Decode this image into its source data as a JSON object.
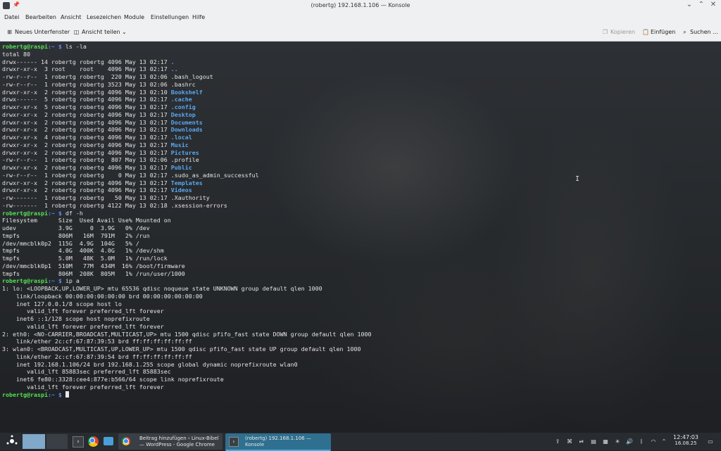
{
  "window": {
    "title": "(robertg) 192.168.1.106 — Konsole"
  },
  "menu": [
    "Datei",
    "Bearbeiten",
    "Ansicht",
    "Lesezeichen",
    "Module",
    "Einstellungen",
    "Hilfe"
  ],
  "toolbar": {
    "new_tab": "Neues Unterfenster",
    "split_view": "Ansicht teilen",
    "copy": "Kopieren",
    "paste": "Einfügen",
    "search": "Suchen …"
  },
  "terminal": {
    "prompt_user": "robertg@raspi",
    "prompt_path": ":~ $",
    "cmd_ls": " ls -la",
    "ls_total": "total 80",
    "ls_rows": [
      {
        "meta": "drwx------ 14 robertg robertg 4096 May 13 02:17 ",
        "name": ".",
        "dir": true
      },
      {
        "meta": "drwxr-xr-x  3 root    root    4096 May 13 02:17 ",
        "name": "..",
        "dir": true
      },
      {
        "meta": "-rw-r--r--  1 robertg robertg  220 May 13 02:06 ",
        "name": ".bash_logout",
        "dir": false
      },
      {
        "meta": "-rw-r--r--  1 robertg robertg 3523 May 13 02:06 ",
        "name": ".bashrc",
        "dir": false
      },
      {
        "meta": "drwxr-xr-x  2 robertg robertg 4096 May 13 02:10 ",
        "name": "Bookshelf",
        "dir": true
      },
      {
        "meta": "drwx------  5 robertg robertg 4096 May 13 02:17 ",
        "name": ".cache",
        "dir": true
      },
      {
        "meta": "drwxr-xr-x  5 robertg robertg 4096 May 13 02:17 ",
        "name": ".config",
        "dir": true
      },
      {
        "meta": "drwxr-xr-x  2 robertg robertg 4096 May 13 02:17 ",
        "name": "Desktop",
        "dir": true
      },
      {
        "meta": "drwxr-xr-x  2 robertg robertg 4096 May 13 02:17 ",
        "name": "Documents",
        "dir": true
      },
      {
        "meta": "drwxr-xr-x  2 robertg robertg 4096 May 13 02:17 ",
        "name": "Downloads",
        "dir": true
      },
      {
        "meta": "drwxr-xr-x  4 robertg robertg 4096 May 13 02:17 ",
        "name": ".local",
        "dir": true
      },
      {
        "meta": "drwxr-xr-x  2 robertg robertg 4096 May 13 02:17 ",
        "name": "Music",
        "dir": true
      },
      {
        "meta": "drwxr-xr-x  2 robertg robertg 4096 May 13 02:17 ",
        "name": "Pictures",
        "dir": true
      },
      {
        "meta": "-rw-r--r--  1 robertg robertg  807 May 13 02:06 ",
        "name": ".profile",
        "dir": false
      },
      {
        "meta": "drwxr-xr-x  2 robertg robertg 4096 May 13 02:17 ",
        "name": "Public",
        "dir": true
      },
      {
        "meta": "-rw-r--r--  1 robertg robertg    0 May 13 02:17 ",
        "name": ".sudo_as_admin_successful",
        "dir": false
      },
      {
        "meta": "drwxr-xr-x  2 robertg robertg 4096 May 13 02:17 ",
        "name": "Templates",
        "dir": true
      },
      {
        "meta": "drwxr-xr-x  2 robertg robertg 4096 May 13 02:17 ",
        "name": "Videos",
        "dir": true
      },
      {
        "meta": "-rw-------  1 robertg robertg   50 May 13 02:17 ",
        "name": ".Xauthority",
        "dir": false
      },
      {
        "meta": "-rw-------  1 robertg robertg 4122 May 13 02:18 ",
        "name": ".xsession-errors",
        "dir": false
      }
    ],
    "cmd_df": " df -h",
    "df_lines": [
      "Filesystem      Size  Used Avail Use% Mounted on",
      "udev            3.9G     0  3.9G   0% /dev",
      "tmpfs           806M   16M  791M   2% /run",
      "/dev/mmcblk0p2  115G  4.9G  104G   5% /",
      "tmpfs           4.0G  400K  4.0G   1% /dev/shm",
      "tmpfs           5.0M   48K  5.0M   1% /run/lock",
      "/dev/mmcblk0p1  510M   77M  434M  16% /boot/firmware",
      "tmpfs           806M  208K  805M   1% /run/user/1000"
    ],
    "cmd_ip": " ip a",
    "ip_lines": [
      "1: lo: <LOOPBACK,UP,LOWER_UP> mtu 65536 qdisc noqueue state UNKNOWN group default qlen 1000",
      "    link/loopback 00:00:00:00:00:00 brd 00:00:00:00:00:00",
      "    inet 127.0.0.1/8 scope host lo",
      "       valid_lft forever preferred_lft forever",
      "    inet6 ::1/128 scope host noprefixroute",
      "       valid_lft forever preferred_lft forever",
      "2: eth0: <NO-CARRIER,BROADCAST,MULTICAST,UP> mtu 1500 qdisc pfifo_fast state DOWN group default qlen 1000",
      "    link/ether 2c:cf:67:87:39:53 brd ff:ff:ff:ff:ff:ff",
      "3: wlan0: <BROADCAST,MULTICAST,UP,LOWER_UP> mtu 1500 qdisc pfifo_fast state UP group default qlen 1000",
      "    link/ether 2c:cf:67:87:39:54 brd ff:ff:ff:ff:ff:ff",
      "    inet 192.168.1.106/24 brd 192.168.1.255 scope global dynamic noprefixroute wlan0",
      "       valid_lft 85883sec preferred_lft 85883sec",
      "    inet6 fe80::3328:cee4:877e:b566/64 scope link noprefixroute",
      "       valid_lft forever preferred_lft forever"
    ]
  },
  "taskbar": {
    "task_chrome_line1": "Beitrag hinzufügen ‹ Linux-Bibel",
    "task_chrome_line2": "— WordPress - Google Chrome",
    "task_konsole_line1": "(robertg) 192.168.1.106 —",
    "task_konsole_line2": "Konsole",
    "clock_time": "12:47:03",
    "clock_date": "16.08.25"
  },
  "colors": {
    "prompt_user": "#55e055",
    "prompt_path": "#5c8ef5",
    "directory": "#5aa8f2",
    "taskbar_active": "#2f6f8f"
  }
}
